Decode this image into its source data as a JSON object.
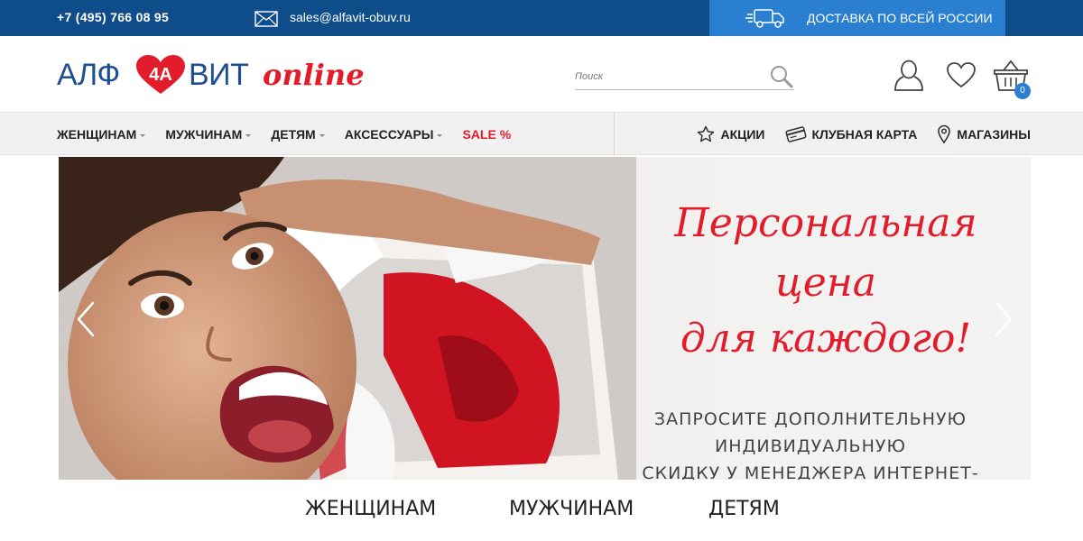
{
  "topbar": {
    "phone": "+7 (495) 766 08 95",
    "email": "sales@alfavit-obuv.ru",
    "delivery": "ДОСТАВКА ПО ВСЕЙ РОССИИ",
    "icons": {
      "mail": "mail-icon",
      "truck": "truck-icon"
    }
  },
  "header": {
    "logo": {
      "part1": "АЛФ",
      "heart_text": "4A",
      "part2": "ВИТ",
      "online": "online"
    },
    "search": {
      "placeholder": "Поиск",
      "value": ""
    },
    "cart_count": "0",
    "icons": {
      "search": "search-icon",
      "user": "user-icon",
      "favorites": "heart-icon",
      "cart": "basket-icon"
    }
  },
  "nav": {
    "items": [
      {
        "label": "ЖЕНЩИНАМ",
        "dropdown": true
      },
      {
        "label": "МУЖЧИНАМ",
        "dropdown": true
      },
      {
        "label": "ДЕТЯМ",
        "dropdown": true
      },
      {
        "label": "АКСЕССУАРЫ",
        "dropdown": true
      },
      {
        "label": "SALE %",
        "dropdown": false
      }
    ],
    "links": [
      {
        "label": "АКЦИИ",
        "icon": "star-icon"
      },
      {
        "label": "КЛУБНАЯ КАРТА",
        "icon": "card-icon"
      },
      {
        "label": "МАГАЗИНЫ",
        "icon": "location-icon"
      }
    ]
  },
  "banner": {
    "title_line1": "Персональная",
    "title_line2": "цена",
    "title_line3": "для каждого!",
    "subtitle_line1": "ЗАПРОСИТЕ ДОПОЛНИТЕЛЬНУЮ ИНДИВИДУАЛЬНУЮ",
    "subtitle_line2": "СКИДКУ У МЕНЕДЖЕРА ИНТЕРНЕТ-МАГАЗИНА"
  },
  "categories": [
    "ЖЕНЩИНАМ",
    "МУЖЧИНАМ",
    "ДЕТЯМ"
  ],
  "colors": {
    "top_bar": "#0f4c8a",
    "delivery_bg": "#2b7fd0",
    "brand_blue": "#1e4f91",
    "brand_red": "#e21c2a",
    "nav_bg": "#f1f1f1"
  }
}
